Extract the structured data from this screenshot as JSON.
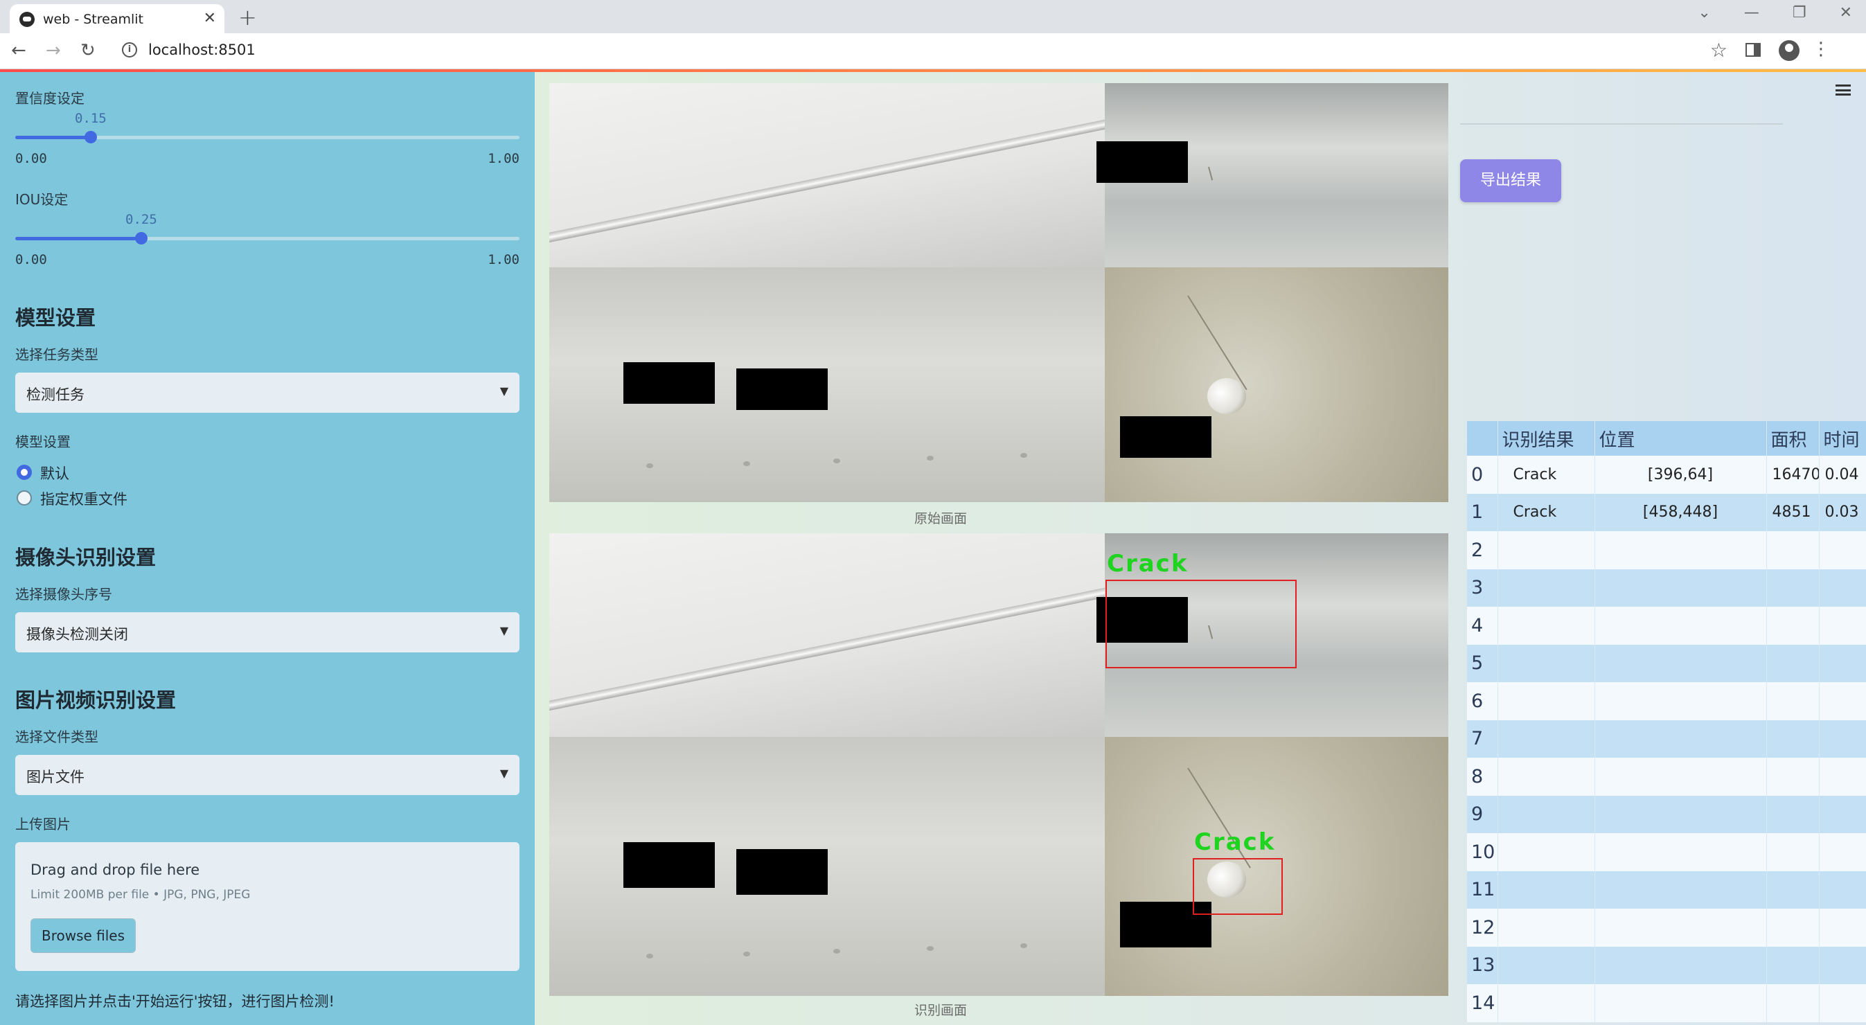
{
  "browser": {
    "tab_title": "web - Streamlit",
    "url": "localhost:8501",
    "new_tab": "+",
    "tab_close": "✕",
    "window_controls": [
      "⌄",
      "—",
      "❐",
      "✕"
    ]
  },
  "sidebar": {
    "confidence": {
      "label": "置信度设定",
      "value": "0.15",
      "value_num": 0.15,
      "min": "0.00",
      "max": "1.00"
    },
    "iou": {
      "label": "IOU设定",
      "value": "0.25",
      "value_num": 0.25,
      "min": "0.00",
      "max": "1.00"
    },
    "model_section": {
      "heading": "模型设置",
      "task_label": "选择任务类型",
      "task_value": "检测任务",
      "weights_label": "模型设置",
      "options": [
        {
          "label": "默认",
          "selected": true
        },
        {
          "label": "指定权重文件",
          "selected": false
        }
      ]
    },
    "camera_section": {
      "heading": "摄像头识别设置",
      "camera_label": "选择摄像头序号",
      "camera_value": "摄像头检测关闭"
    },
    "file_section": {
      "heading": "图片视频识别设置",
      "type_label": "选择文件类型",
      "type_value": "图片文件",
      "upload_label": "上传图片",
      "upload_title": "Drag and drop file here",
      "upload_limit": "Limit 200MB per file • JPG, PNG, JPEG",
      "browse_label": "Browse files"
    },
    "hint": "请选择图片并点击'开始运行'按钮，进行图片检测!"
  },
  "main": {
    "original_caption": "原始画面",
    "result_caption": "识别画面",
    "detection_labels": [
      "Crack",
      "Crack"
    ],
    "export_label": "导出结果"
  },
  "table": {
    "headers": [
      "",
      "识别结果",
      "位置",
      "面积",
      "时间"
    ],
    "rows": [
      {
        "idx": "0",
        "cls": "Crack",
        "pos": "[396,64]",
        "area": "16470",
        "time": "0.04"
      },
      {
        "idx": "1",
        "cls": "Crack",
        "pos": "[458,448]",
        "area": "4851",
        "time": "0.03"
      },
      {
        "idx": "2",
        "cls": "",
        "pos": "",
        "area": "",
        "time": ""
      },
      {
        "idx": "3",
        "cls": "",
        "pos": "",
        "area": "",
        "time": ""
      },
      {
        "idx": "4",
        "cls": "",
        "pos": "",
        "area": "",
        "time": ""
      },
      {
        "idx": "5",
        "cls": "",
        "pos": "",
        "area": "",
        "time": ""
      },
      {
        "idx": "6",
        "cls": "",
        "pos": "",
        "area": "",
        "time": ""
      },
      {
        "idx": "7",
        "cls": "",
        "pos": "",
        "area": "",
        "time": ""
      },
      {
        "idx": "8",
        "cls": "",
        "pos": "",
        "area": "",
        "time": ""
      },
      {
        "idx": "9",
        "cls": "",
        "pos": "",
        "area": "",
        "time": ""
      },
      {
        "idx": "10",
        "cls": "",
        "pos": "",
        "area": "",
        "time": ""
      },
      {
        "idx": "11",
        "cls": "",
        "pos": "",
        "area": "",
        "time": ""
      },
      {
        "idx": "12",
        "cls": "",
        "pos": "",
        "area": "",
        "time": ""
      },
      {
        "idx": "13",
        "cls": "",
        "pos": "",
        "area": "",
        "time": ""
      },
      {
        "idx": "14",
        "cls": "",
        "pos": "",
        "area": "",
        "time": ""
      }
    ]
  },
  "icons": {
    "back": "back-arrow-icon",
    "forward": "forward-arrow-icon",
    "reload": "reload-icon",
    "info": "site-info-icon",
    "star": "bookmark-star-icon",
    "side_panel": "side-panel-icon",
    "profile": "profile-icon",
    "menu": "kebab-menu-icon",
    "app_menu": "hamburger-icon",
    "caret": "chevron-down-icon"
  },
  "colors": {
    "sidebar_bg": "#7ec6dc",
    "accent": "#4169e1",
    "export_button": "#8e87e8",
    "detection_box": "#e02020",
    "detection_label": "#1ed41e",
    "table_header": "#a9d2f0"
  }
}
